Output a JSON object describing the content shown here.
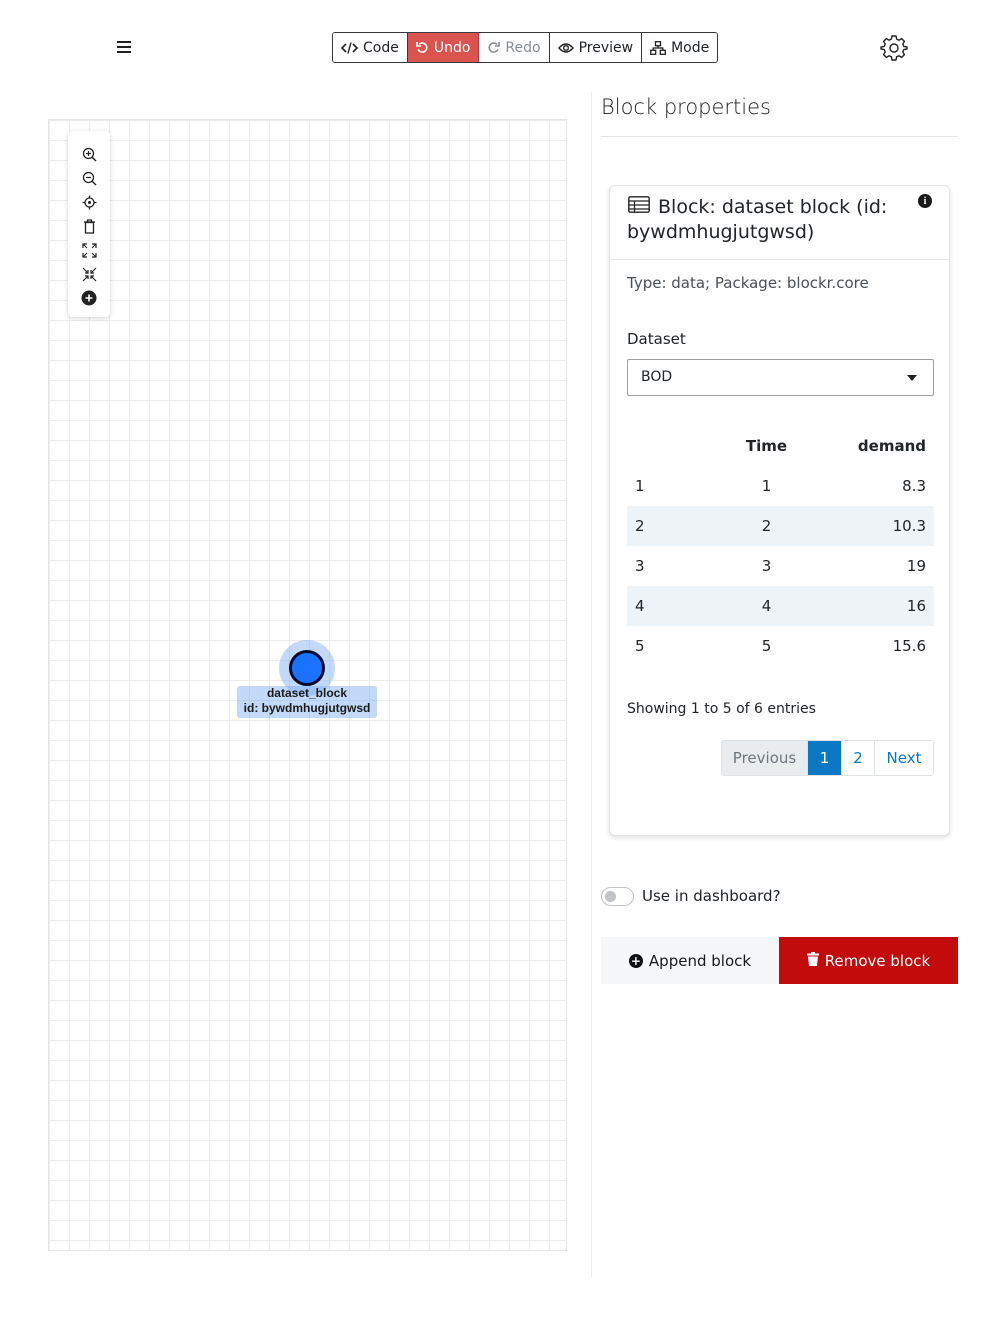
{
  "toolbar": {
    "code_label": "Code",
    "undo_label": "Undo",
    "redo_label": "Redo",
    "preview_label": "Preview",
    "mode_label": "Mode",
    "undo_color": "#d9534f"
  },
  "icons": {
    "menu": "hamburger-icon",
    "settings": "gear-icon"
  },
  "canvas": {
    "zoom_controls": [
      "zoom-in-icon",
      "zoom-out-icon",
      "locate-icon",
      "delete-icon",
      "fit-icon",
      "collapse-icon",
      "add-icon"
    ],
    "node": {
      "name": "dataset_block",
      "id_text": "id: bywdmhugjutgwsd",
      "color": "#1a73ff"
    }
  },
  "panel": {
    "title": "Block properties",
    "card": {
      "title": "Block: dataset block (id: bywdmhugjutgwsd)",
      "type_text": "Type: data; Package: blockr.core",
      "dataset_label": "Dataset",
      "dataset_value": "BOD",
      "table": {
        "columns": [
          "",
          "Time",
          "demand"
        ],
        "rows": [
          [
            "1",
            "1",
            "8.3"
          ],
          [
            "2",
            "2",
            "10.3"
          ],
          [
            "3",
            "3",
            "19"
          ],
          [
            "4",
            "4",
            "16"
          ],
          [
            "5",
            "5",
            "15.6"
          ]
        ]
      },
      "entries_text": "Showing 1 to 5 of 6 entries",
      "pager": {
        "previous": "Previous",
        "page1": "1",
        "page2": "2",
        "next": "Next"
      }
    },
    "dashboard_toggle_label": "Use in dashboard?",
    "append_label": "Append block",
    "remove_label": "Remove block",
    "remove_color": "#c20b0b"
  }
}
